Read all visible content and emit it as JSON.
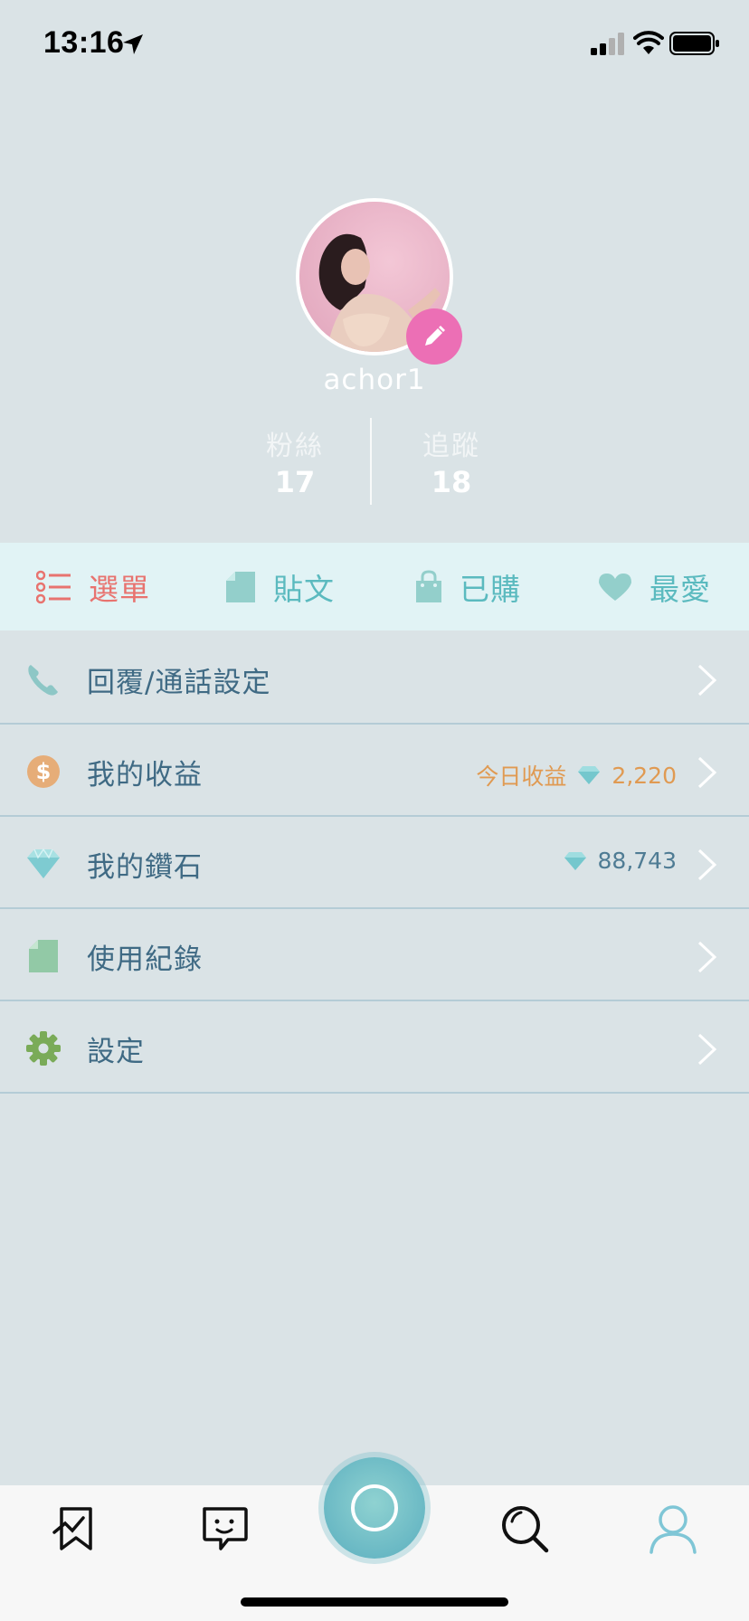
{
  "status_bar": {
    "time": "13:16"
  },
  "profile": {
    "username": "achor1",
    "stats": [
      {
        "label": "粉絲",
        "value": "17"
      },
      {
        "label": "追蹤",
        "value": "18"
      }
    ]
  },
  "tabs": [
    {
      "label": "選單",
      "color": "#e8736f"
    },
    {
      "label": "貼文",
      "color": "#5bbabf"
    },
    {
      "label": "已購",
      "color": "#5bbabf"
    },
    {
      "label": "最愛",
      "color": "#5bbabf"
    }
  ],
  "menu": {
    "items": [
      {
        "label": "回覆/通話設定"
      },
      {
        "label": "我的收益",
        "info_label": "今日收益",
        "info_value": "2,220"
      },
      {
        "label": "我的鑽石",
        "info_value": "88,743"
      },
      {
        "label": "使用紀錄"
      },
      {
        "label": "設定"
      }
    ]
  },
  "colors": {
    "background": "#dae3e6",
    "accent_pink": "#ec6fb5",
    "earnings_orange": "#e09a52",
    "teal": "#5bbabf"
  }
}
